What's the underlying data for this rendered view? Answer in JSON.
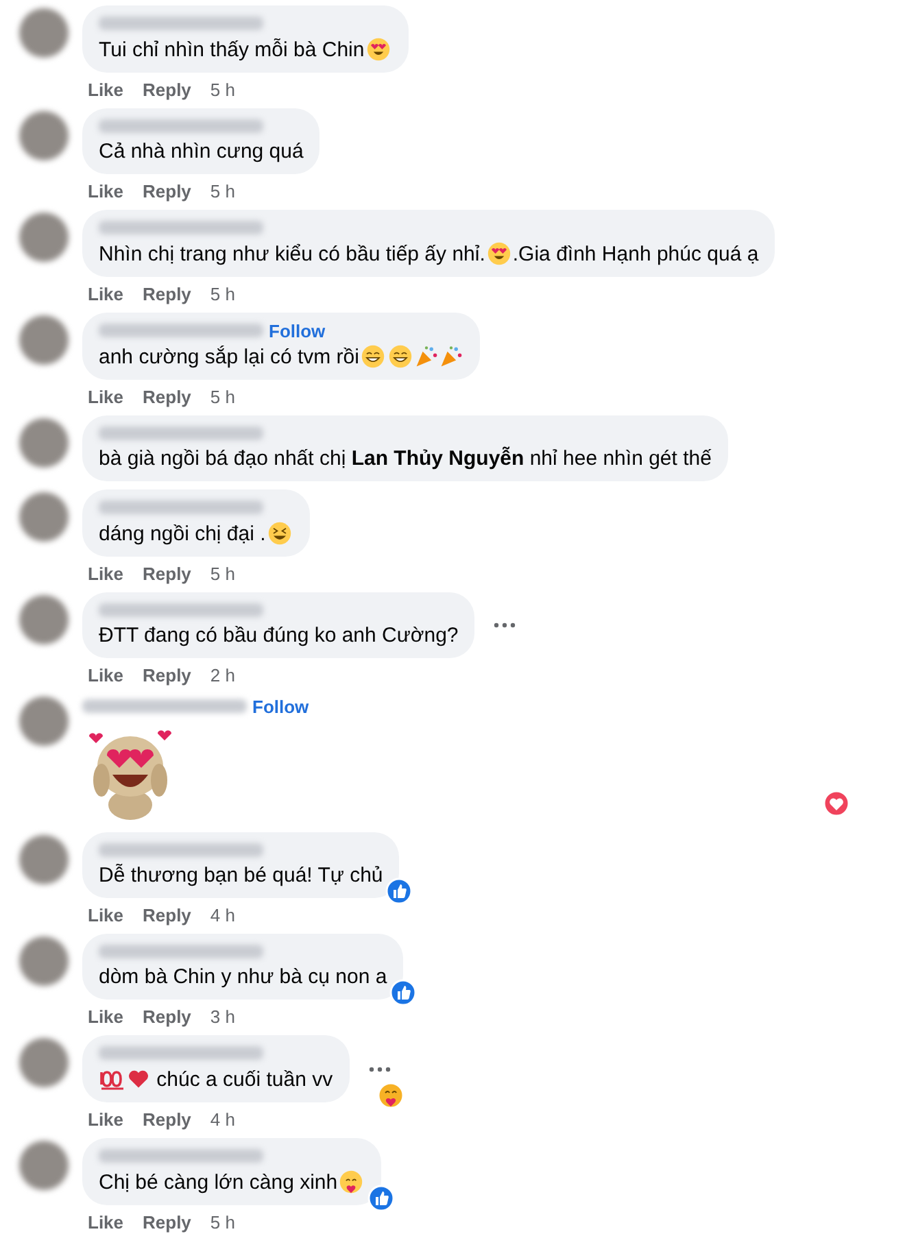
{
  "comments": [
    {
      "parts": [
        {
          "kind": "text",
          "text": "Tui chỉ nhìn thấy mỗi bà Chin"
        },
        {
          "kind": "hearteyes"
        }
      ],
      "more": false,
      "actions": [
        "Like",
        "Reply",
        "5 h"
      ]
    },
    {
      "parts": [
        {
          "kind": "text",
          "text": "Cả nhà nhìn cưng quá"
        }
      ],
      "more": false,
      "actions": [
        "Like",
        "Reply",
        "5 h"
      ]
    },
    {
      "parts": [
        {
          "kind": "text",
          "text": "Nhìn chị trang như kiểu có bầu tiếp ấy nhỉ."
        },
        {
          "kind": "hearteyes"
        },
        {
          "kind": "text",
          "text": ".Gia đình Hạnh phúc quá ạ"
        }
      ],
      "more": false,
      "actions": [
        "Like",
        "Reply",
        "5 h"
      ]
    },
    {
      "follow": "Follow",
      "parts": [
        {
          "kind": "text",
          "text": "anh cường sắp lại có tvm rồi"
        },
        {
          "kind": "grin"
        },
        {
          "kind": "grin"
        },
        {
          "kind": "party"
        },
        {
          "kind": "party"
        }
      ],
      "more": false,
      "actions": [
        "Like",
        "Reply",
        "5 h"
      ]
    },
    {
      "parts": [
        {
          "kind": "text",
          "text": "bà già ngồi bá đạo nhất chị **Lan Thủy Nguyễn** nhỉ hee nhìn gét thế"
        }
      ],
      "more": false
    },
    {
      "parts": [
        {
          "kind": "text",
          "text": "dáng ngồi chị đại ."
        },
        {
          "kind": "laugh"
        }
      ],
      "more": false,
      "actions": [
        "Like",
        "Reply",
        "5 h"
      ]
    },
    {
      "parts": [
        {
          "kind": "text",
          "text": "ĐTT đang có bầu đúng ko anh Cường?"
        }
      ],
      "more": true,
      "actions": [
        "Like",
        "Reply",
        "2 h"
      ]
    },
    {
      "follow": "Follow",
      "parts": [
        {
          "kind": "sticker"
        }
      ],
      "reaction": {
        "kind": "love"
      },
      "more": false
    },
    {
      "parts": [
        {
          "kind": "text",
          "text": "Dễ thương bạn bé quá! Tự chủ"
        }
      ],
      "reaction": {
        "kind": "like"
      },
      "more": false,
      "actions": [
        "Like",
        "Reply",
        "4 h"
      ]
    },
    {
      "parts": [
        {
          "kind": "text",
          "text": "dòm bà Chin y như bà cụ non a"
        }
      ],
      "reaction": {
        "kind": "like"
      },
      "more": false,
      "actions": [
        "Like",
        "Reply",
        "3 h"
      ]
    },
    {
      "parts": [
        {
          "kind": "hundred"
        },
        {
          "kind": "heart"
        },
        {
          "kind": "text",
          "text": " chúc a cuối tuần vv"
        }
      ],
      "reaction": {
        "kind": "care"
      },
      "more": true,
      "actions": [
        "Like",
        "Reply",
        "4 h"
      ]
    },
    {
      "parts": [
        {
          "kind": "text",
          "text": "Chị bé càng lớn càng xinh"
        },
        {
          "kind": "hug"
        }
      ],
      "reaction": {
        "kind": "like"
      },
      "more": false,
      "actions": [
        "Like",
        "Reply",
        "5 h"
      ]
    }
  ]
}
